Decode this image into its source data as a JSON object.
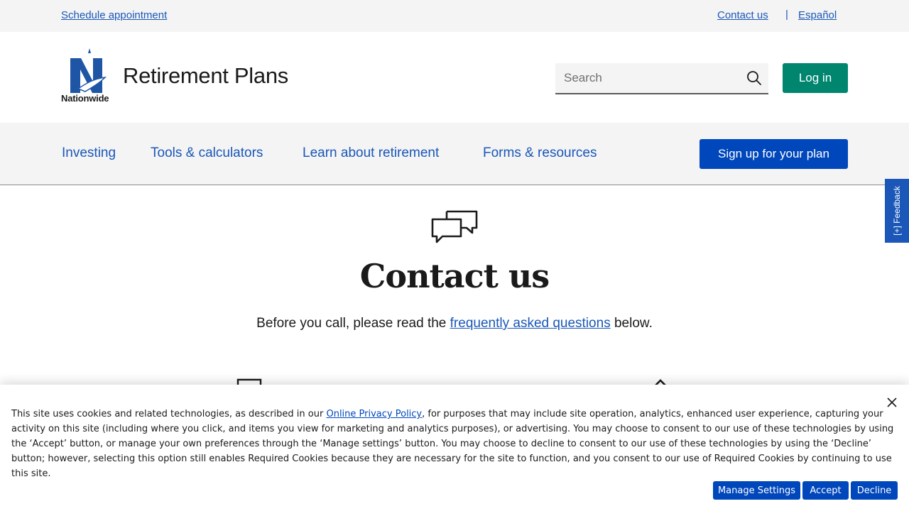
{
  "utility": {
    "schedule": "Schedule appointment",
    "contact": "Contact us",
    "separator": "|",
    "language": "Español"
  },
  "header": {
    "logo_word": "Nationwide",
    "brand_title": "Retirement Plans",
    "search_placeholder": "Search",
    "login": "Log in"
  },
  "nav": {
    "items": [
      "Investing",
      "Tools & calculators",
      "Learn about retirement",
      "Forms & resources"
    ],
    "signup": "Sign up for your plan"
  },
  "feedback": "[+] Feedback",
  "main": {
    "title": "Contact us",
    "intro_before": "Before you call, please read the ",
    "intro_link": "frequently asked questions",
    "intro_after": " below."
  },
  "cookie": {
    "text_before": "This site uses cookies and related technologies, as described in our ",
    "link": "Online Privacy Policy",
    "text_after": ", for purposes that may include site operation, analytics, enhanced user experience, capturing your activity on this site (including where you click, and items you view for marketing and analytics purposes), or advertising. You may choose to consent to our use of these technologies by using the ‘Accept’ button, or manage your own preferences through the ‘Manage settings’ button. You may choose to decline to consent to our use of these technologies by using the ‘Decline’ button; however, selecting this option still enables Required Cookies because they are necessary for the site to function, and you consent to our use of Required Cookies by continuing to use this site.",
    "manage": "Manage Settings",
    "accept": "Accept",
    "decline": "Decline"
  },
  "colors": {
    "link_blue": "#1a57b8",
    "primary_blue": "#0047bb",
    "login_green": "#00856f",
    "utility_bg": "#f4f4f4"
  },
  "icons": [
    "search-icon",
    "chat-bubbles-icon",
    "close-icon",
    "nationwide-eagle-logo"
  ]
}
